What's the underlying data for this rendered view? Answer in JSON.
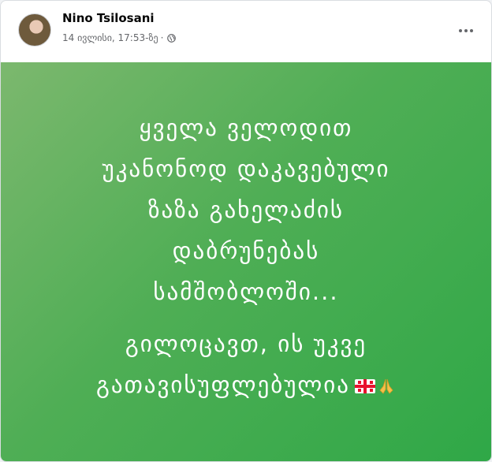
{
  "post": {
    "author": "Nino Tsilosani",
    "timestamp": "14 ივლისი, 17:53-ზე",
    "separator": "·",
    "privacy_icon": "globe-icon",
    "menu_icon": "more-options-icon"
  },
  "content": {
    "paragraph1": "ყველა ველოდით\nუკანონოდ დაკავებული\nზაზა გახელაძის\nდაბრუნებას\nსამშობლოში...",
    "paragraph2": "გილოცავთ, ის უკვე\nგათავისუფლებულია",
    "emojis": [
      "georgia-flag-icon",
      "folded-hands-icon"
    ],
    "background_colors": [
      "#7cb86e",
      "#2fa847"
    ]
  }
}
